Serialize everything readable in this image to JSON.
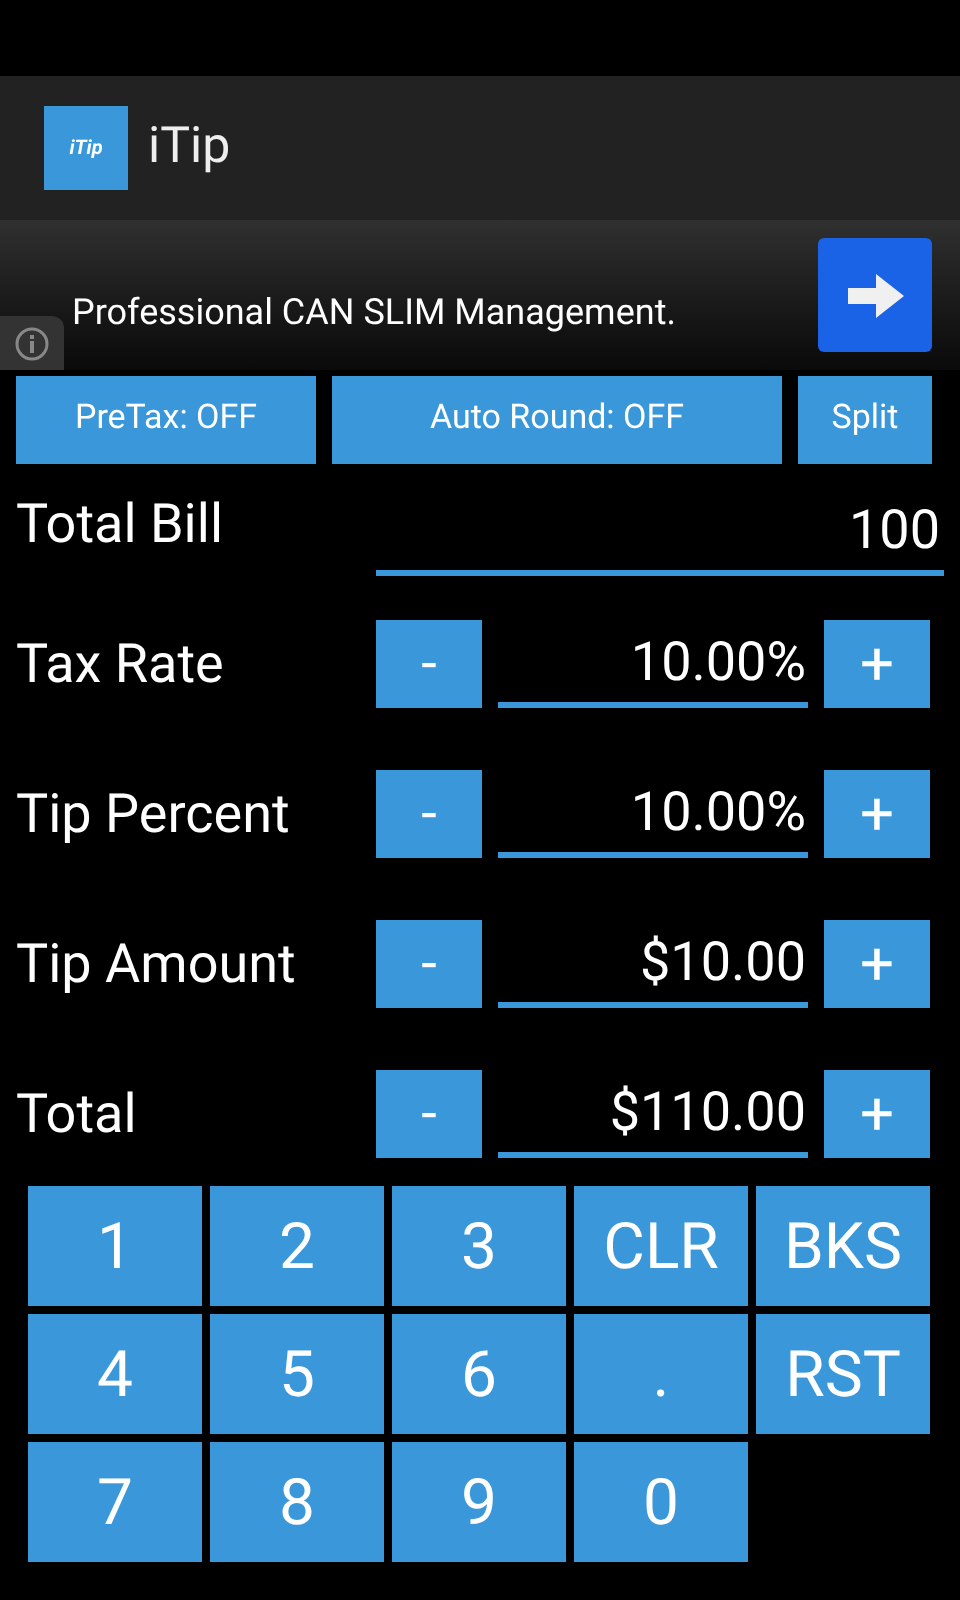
{
  "app_bar": {
    "logo_text": "iTip",
    "title": "iTip"
  },
  "ad": {
    "text": "Professional CAN SLIM Management."
  },
  "toggles": [
    {
      "label": "PreTax: OFF"
    },
    {
      "label": "Auto Round: OFF"
    },
    {
      "label": "Split"
    }
  ],
  "total_bill": {
    "label": "Total Bill",
    "value": "100"
  },
  "rows": [
    {
      "label": "Tax Rate",
      "minus": "-",
      "value": "10.00%",
      "plus": "+"
    },
    {
      "label": "Tip Percent",
      "minus": "-",
      "value": "10.00%",
      "plus": "+"
    },
    {
      "label": "Tip Amount",
      "minus": "-",
      "value": "$10.00",
      "plus": "+"
    },
    {
      "label": "Total",
      "minus": "-",
      "value": "$110.00",
      "plus": "+"
    }
  ],
  "keypad": [
    [
      "1",
      "2",
      "3",
      "CLR",
      "BKS"
    ],
    [
      "4",
      "5",
      "6",
      ".",
      "RST"
    ],
    [
      "7",
      "8",
      "9",
      "0"
    ]
  ]
}
